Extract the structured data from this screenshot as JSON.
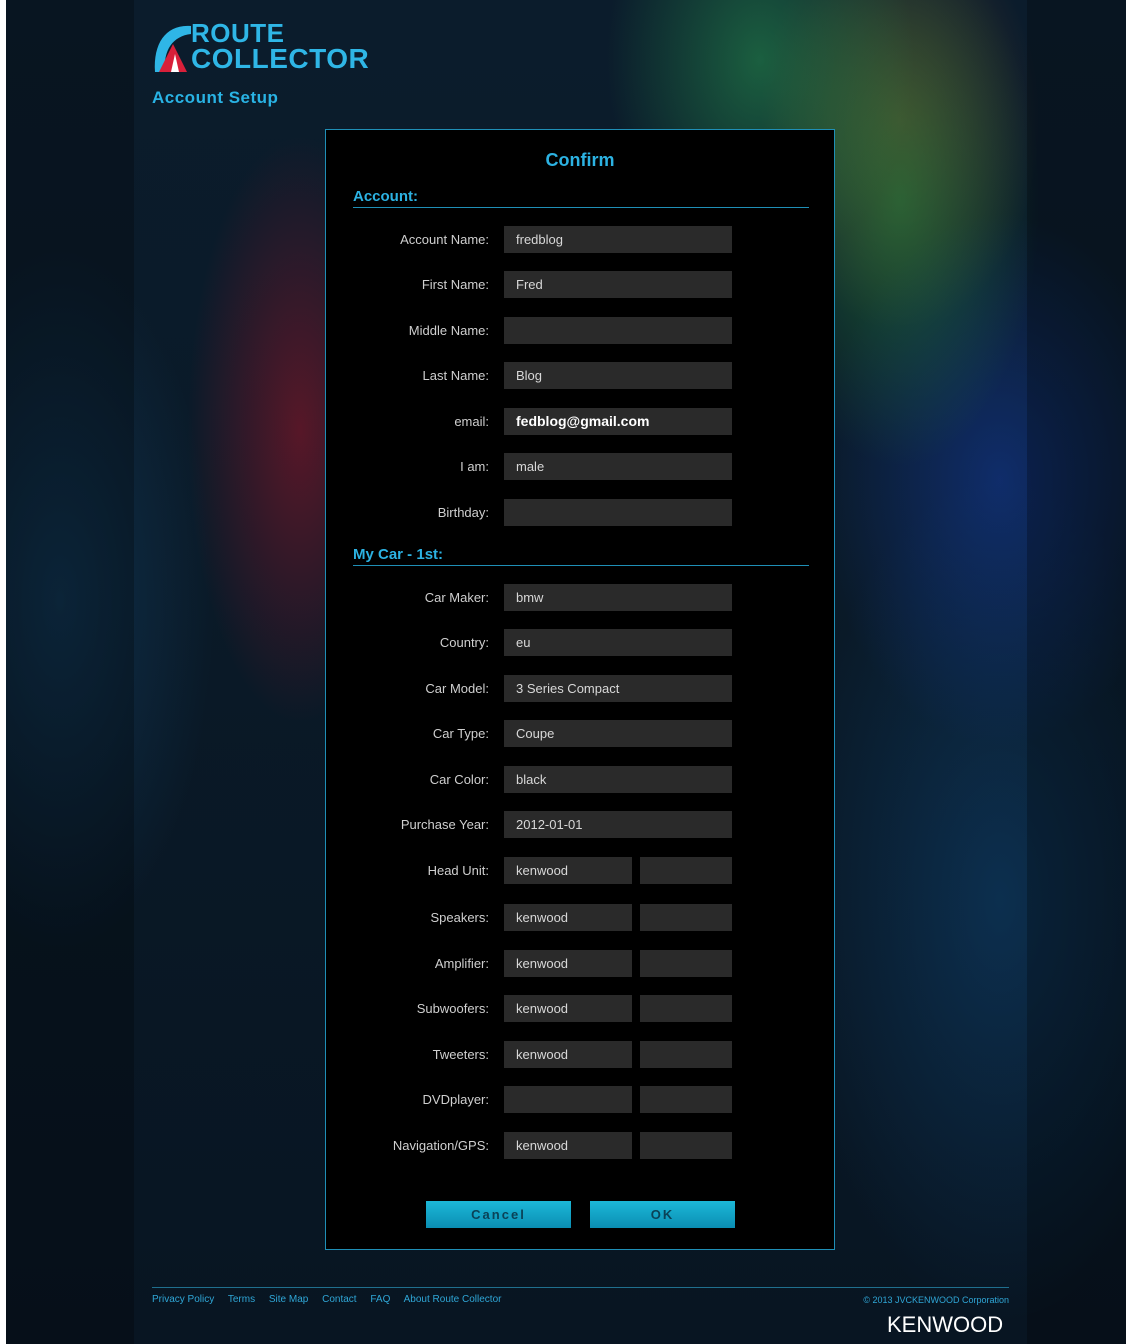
{
  "header": {
    "logo_line1": "ROUTE",
    "logo_line2": "COLLECTOR",
    "subtitle": "Account Setup"
  },
  "dialog": {
    "title": "Confirm",
    "account_section": "Account:",
    "car_section": "My Car - 1st:",
    "account_fields": [
      {
        "label": "Account Name:",
        "value": "fredblog"
      },
      {
        "label": "First Name:",
        "value": "Fred"
      },
      {
        "label": "Middle Name:",
        "value": ""
      },
      {
        "label": "Last Name:",
        "value": "Blog"
      },
      {
        "label": "email:",
        "value": "fedblog@gmail.com"
      },
      {
        "label": "I am:",
        "value": "male"
      },
      {
        "label": "Birthday:",
        "value": ""
      }
    ],
    "car_fields": [
      {
        "label": "Car Maker:",
        "value": "bmw"
      },
      {
        "label": "Country:",
        "value": "eu"
      },
      {
        "label": "Car Model:",
        "value": "3 Series Compact"
      },
      {
        "label": "Car Type:",
        "value": "Coupe"
      },
      {
        "label": "Car Color:",
        "value": "black"
      },
      {
        "label": "Purchase Year:",
        "value": "2012-01-01"
      }
    ],
    "audio_fields": [
      {
        "label": "Head Unit:",
        "value": "kenwood",
        "value2": ""
      },
      {
        "label": "Speakers:",
        "value": "kenwood",
        "value2": ""
      },
      {
        "label": "Amplifier:",
        "value": "kenwood",
        "value2": ""
      },
      {
        "label": "Subwoofers:",
        "value": "kenwood",
        "value2": ""
      },
      {
        "label": "Tweeters:",
        "value": "kenwood",
        "value2": ""
      },
      {
        "label": "DVDplayer:",
        "value": "",
        "value2": ""
      },
      {
        "label": "Navigation/GPS:",
        "value": "kenwood",
        "value2": ""
      }
    ],
    "cancel_label": "Cancel",
    "ok_label": "OK"
  },
  "footer": {
    "links": [
      "Privacy Policy",
      "Terms",
      "Site Map",
      "Contact",
      "FAQ",
      "About Route Collector"
    ],
    "copyright": "© 2013 JVCKENWOOD Corporation",
    "brand": "KENWOOD"
  },
  "colors": {
    "accent": "#2cb2e2",
    "panel_bg": "#000000",
    "field_bg": "#2a2a2a",
    "button": "#12a6cb"
  }
}
